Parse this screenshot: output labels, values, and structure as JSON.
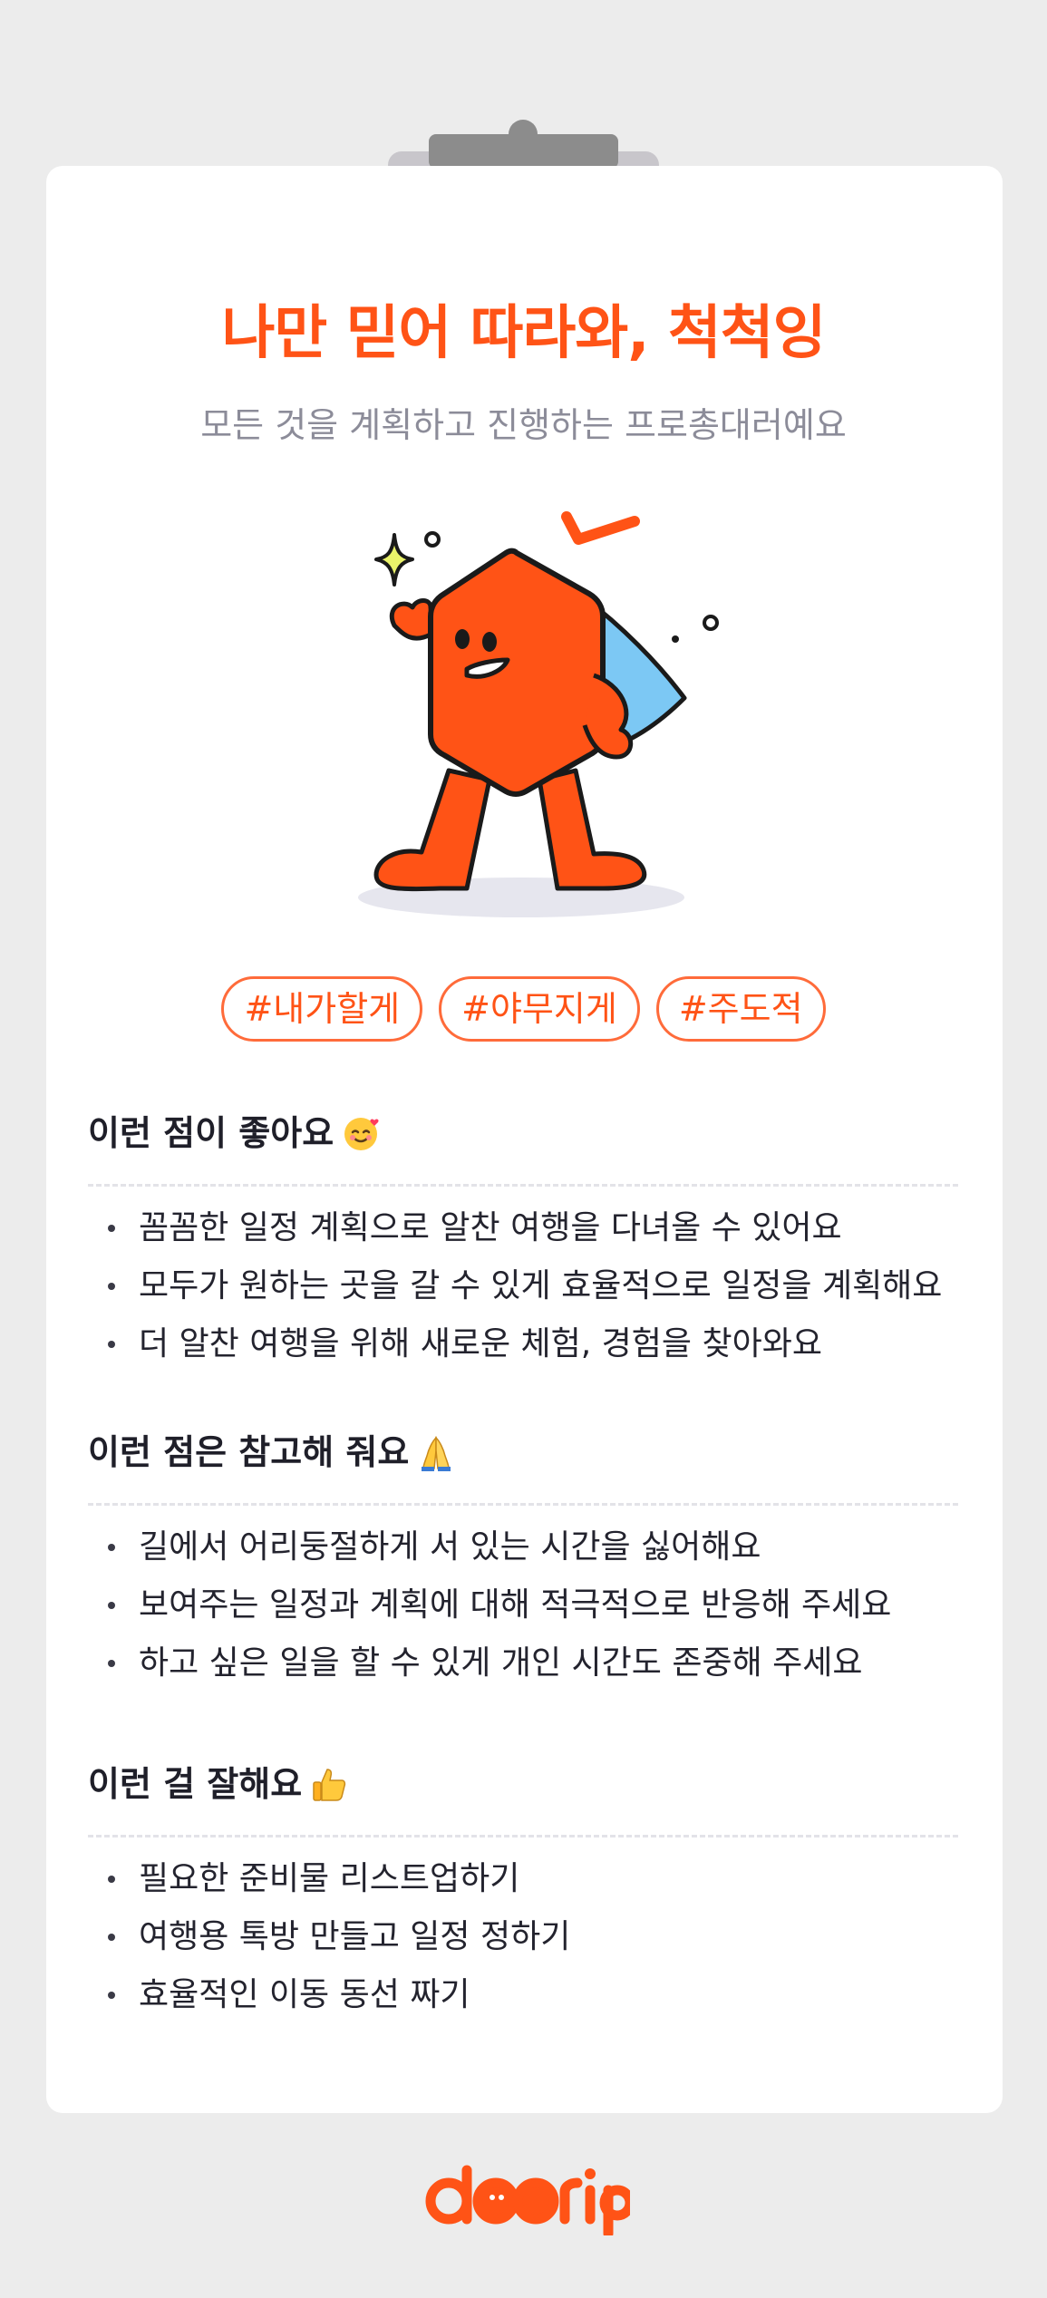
{
  "card": {
    "title": "나만 믿어 따라와, 척척잉",
    "subtitle": "모든 것을 계획하고 진행하는 프로총대러예요"
  },
  "tags": [
    "#내가할게",
    "#야무지게",
    "#주도적"
  ],
  "sections": [
    {
      "title": "이런 점이 좋아요",
      "emoji": "smiling-face-with-hearts-icon",
      "items": [
        "꼼꼼한 일정 계획으로 알찬 여행을 다녀올 수 있어요",
        "모두가 원하는 곳을 갈 수 있게 효율적으로 일정을 계획해요",
        "더 알찬 여행을 위해 새로운 체험, 경험을 찾아와요"
      ]
    },
    {
      "title": "이런 점은 참고해 줘요",
      "emoji": "folded-hands-icon",
      "items": [
        "길에서 어리둥절하게 서 있는 시간을 싫어해요",
        "보여주는 일정과 계획에 대해 적극적으로 반응해 주세요",
        "하고 싶은 일을 할 수 있게 개인 시간도 존중해 주세요"
      ]
    },
    {
      "title": "이런 걸 잘해요",
      "emoji": "thumbs-up-icon",
      "items": [
        "필요한 준비물 리스트업하기",
        "여행용 톡방 만들고 일정 정하기",
        "효율적인 이동 동선 짜기"
      ]
    }
  ],
  "logo": {
    "text": "doorip"
  },
  "colors": {
    "accent": "#ff5316",
    "subtitle": "#8c8c99",
    "background": "#ececec",
    "card": "#ffffff",
    "cape": "#7cc8f4"
  }
}
